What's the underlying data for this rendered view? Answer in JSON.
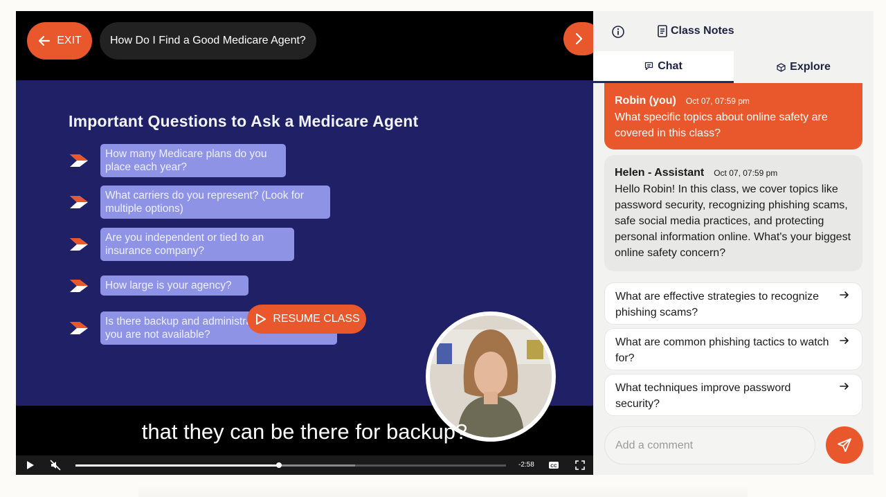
{
  "player": {
    "exit_label": "EXIT",
    "class_title": "How Do I Find a Good Medicare Agent?",
    "resume_label": "RESUME CLASS",
    "caption": "that they can be there for backup?",
    "time_remaining": "-2:58",
    "progress_fraction": 0.473,
    "buffered_fraction": 0.65,
    "accent_color": "#e9582d"
  },
  "slide": {
    "title": "Important Questions to Ask a Medicare Agent",
    "questions": [
      "How many Medicare plans do you place each year?",
      "What carriers do you represent? (Look for multiple options)",
      "Are you independent or tied to an insurance company?",
      "How large is your agency?",
      "Is there backup and administration support if you are not available?"
    ],
    "background_color": "#1f2066"
  },
  "panel": {
    "notes_label": "Class Notes",
    "tabs": [
      {
        "label": "Chat",
        "active": true
      },
      {
        "label": "Explore",
        "active": false
      }
    ],
    "messages": [
      {
        "author": "Robin (you)",
        "time": "Oct 07, 07:59 pm",
        "text": "What specific topics about online safety are covered in this class?"
      },
      {
        "author": "Helen - Assistant",
        "time": "Oct 07, 07:59 pm",
        "text": "Hello Robin! In this class, we cover topics like password security, recognizing phishing scams, safe social media practices, and protecting personal information online. What's your biggest online safety concern?"
      }
    ],
    "suggestions": [
      "What are effective strategies to recognize phishing scams?",
      "What are common phishing tactics to watch for?",
      "What techniques improve password security?"
    ],
    "comment_placeholder": "Add a comment"
  },
  "icons": {
    "exit": "arrow-left-icon",
    "next": "chevron-right-icon",
    "resume": "play-icon",
    "info": "info-icon",
    "notes": "notes-icon",
    "chat": "chat-icon",
    "explore": "cube-icon",
    "suggestion": "arrow-right-icon",
    "send": "send-icon"
  }
}
